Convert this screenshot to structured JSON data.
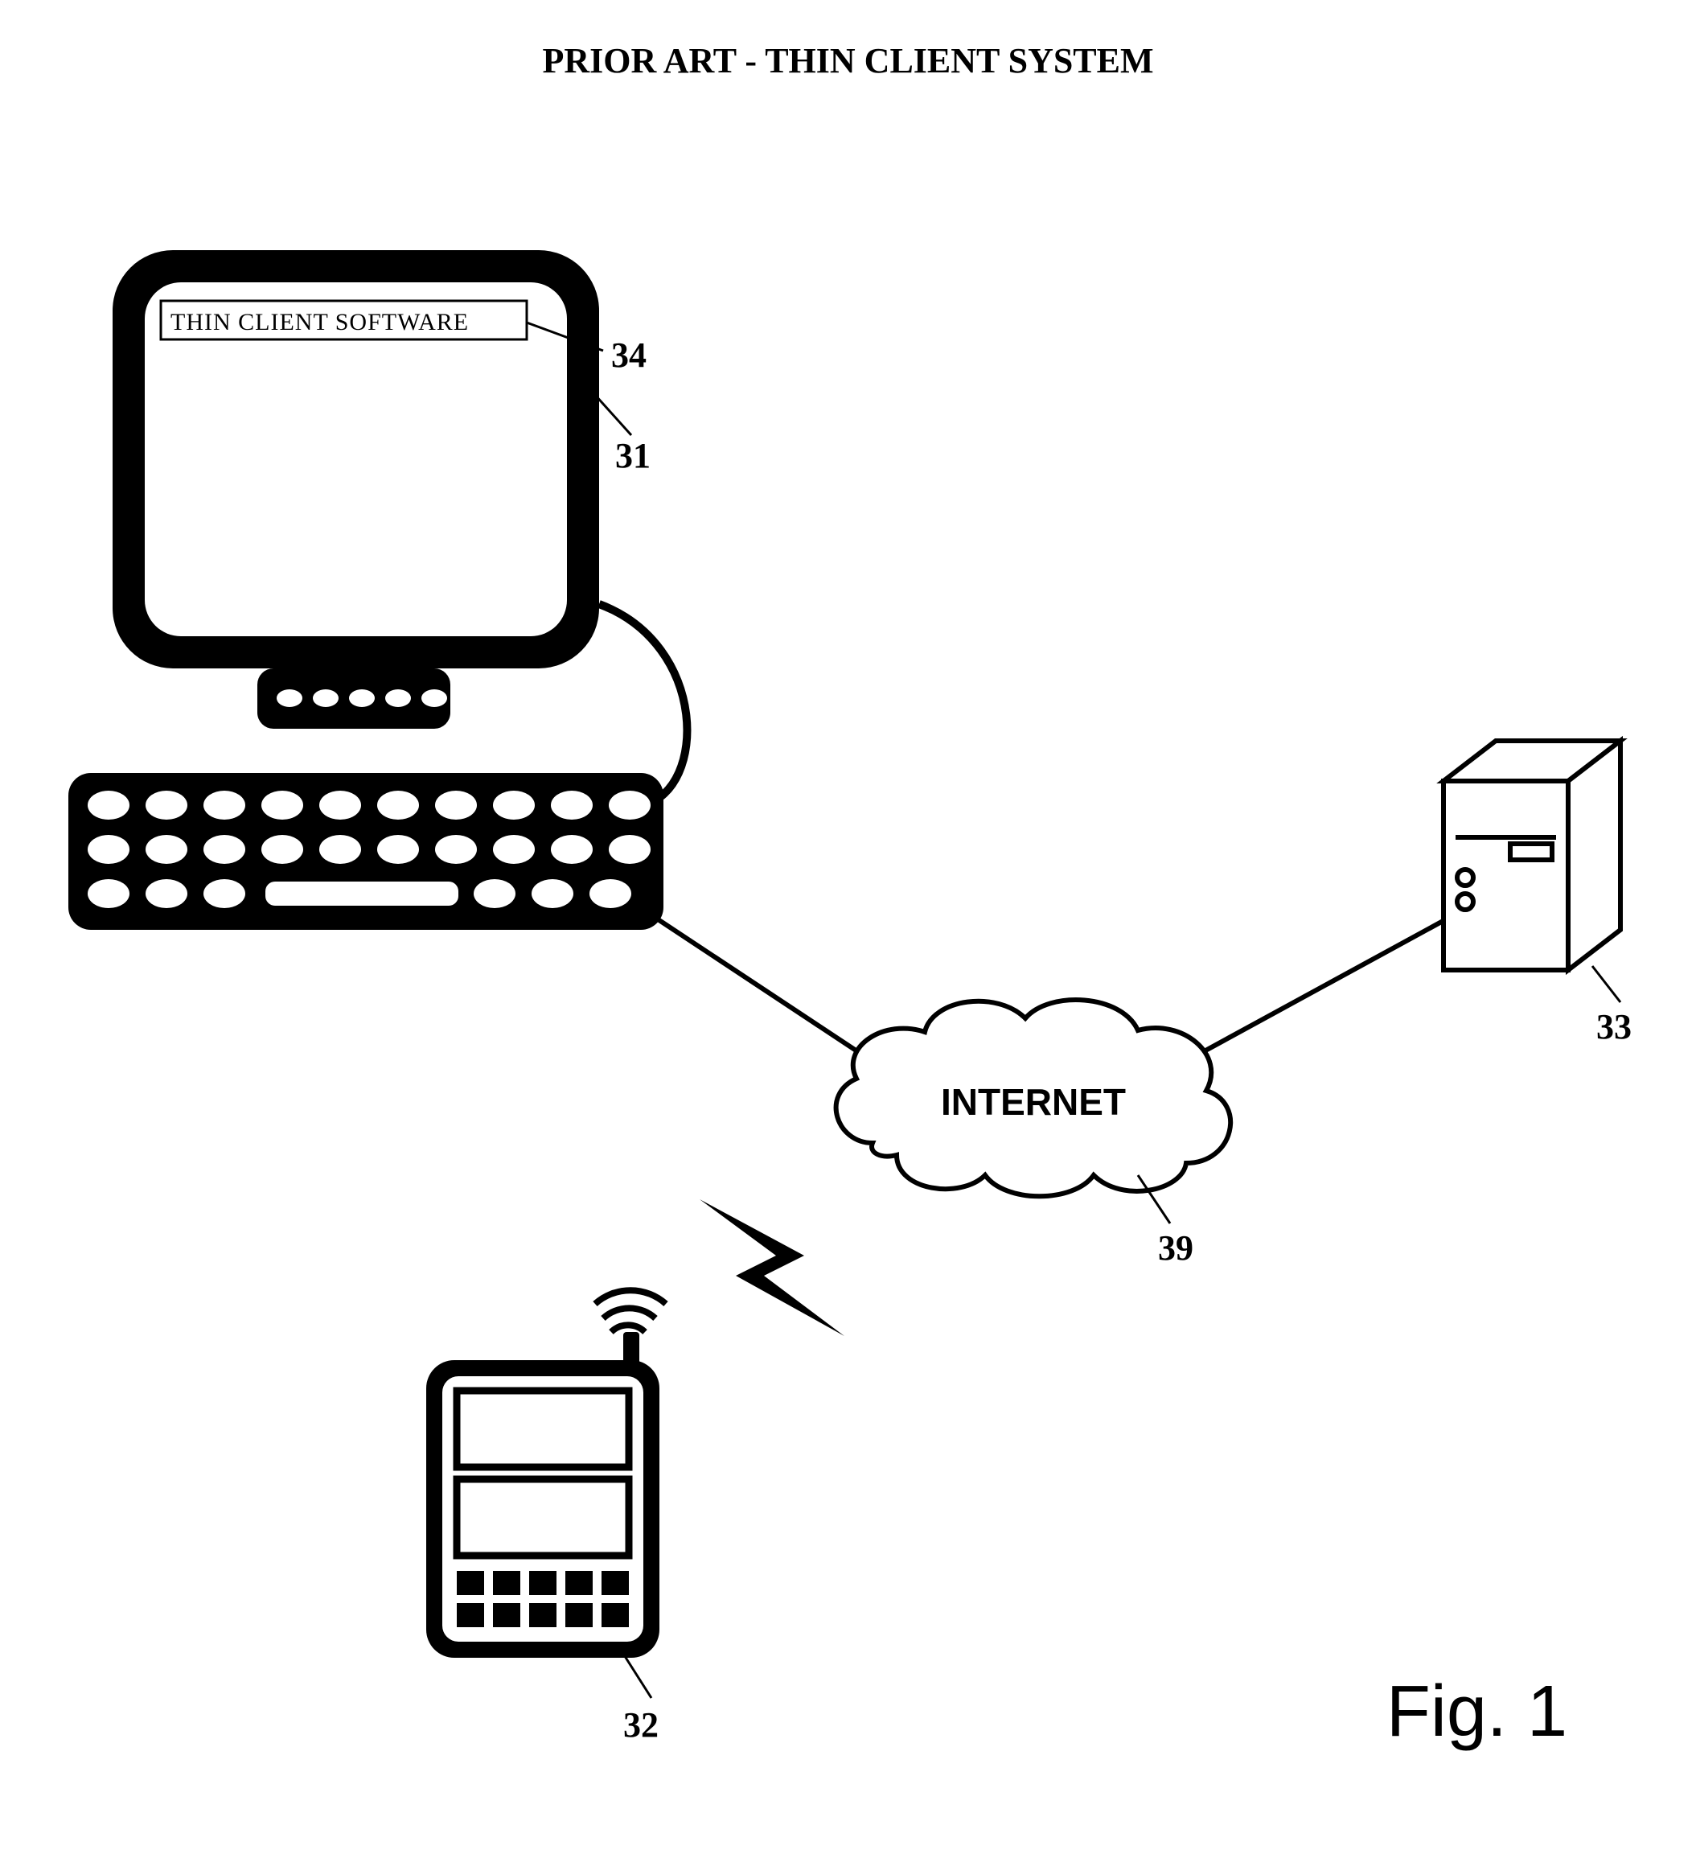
{
  "title": "PRIOR ART - THIN CLIENT SYSTEM",
  "monitor": {
    "software_label": "THIN CLIENT SOFTWARE"
  },
  "cloud": {
    "label": "INTERNET"
  },
  "refs": {
    "monitor_outer": "31",
    "software_bar": "34",
    "pda": "32",
    "server": "33",
    "cloud": "39"
  },
  "figure_label": "Fig. 1"
}
